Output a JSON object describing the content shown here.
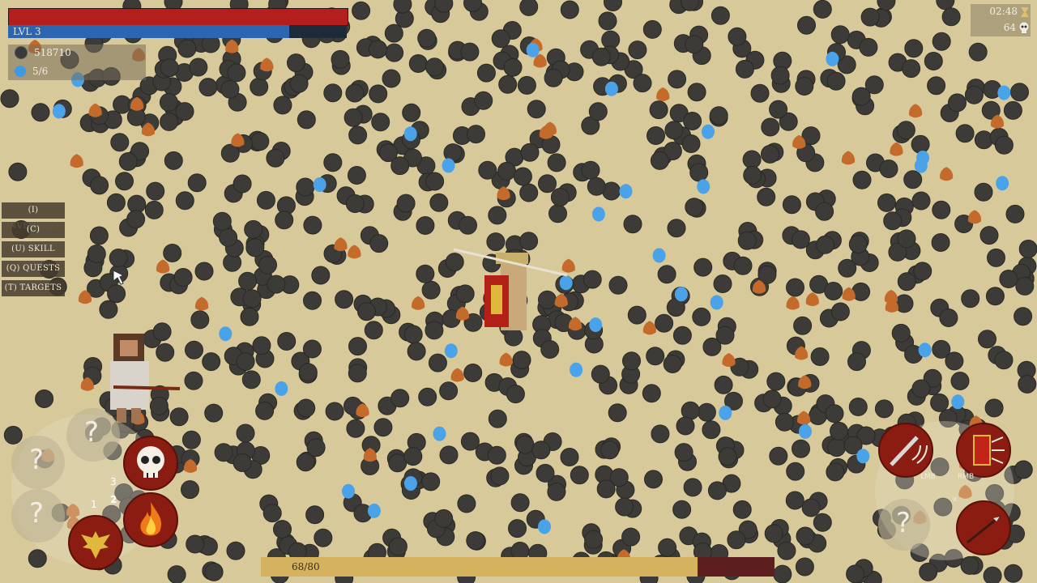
{
  "hud": {
    "health_percent": 100,
    "level_label": "LVL 3",
    "xp_percent": 83,
    "gold_amount": "518710",
    "gems_count": "5/6",
    "timer": "02:48",
    "kill_count": "64"
  },
  "menu": {
    "items": [
      {
        "label": "(I) INVENTORY"
      },
      {
        "label": "(C) CRAFTING"
      },
      {
        "label": "(U) SKILL TREE"
      },
      {
        "label": "(Q) QUESTS"
      },
      {
        "label": "(T) TARGETS"
      }
    ]
  },
  "abilities": {
    "slot_unknown_symbol": "?",
    "slot_number_1": "1",
    "slot_number_2": "2",
    "slot_number_3": "3"
  },
  "attack": {
    "lmb_label": "LMB",
    "rmb_label": "RMB",
    "x_label": "x",
    "unknown_symbol": "?"
  },
  "stamina": {
    "label": "68/80",
    "percent": 85
  },
  "colors": {
    "health": "#b41e1c",
    "xp": "#2c66b0",
    "stamina": "#d4b25e",
    "sand": "#d8c99a",
    "enemy": "#3a3a3a"
  }
}
